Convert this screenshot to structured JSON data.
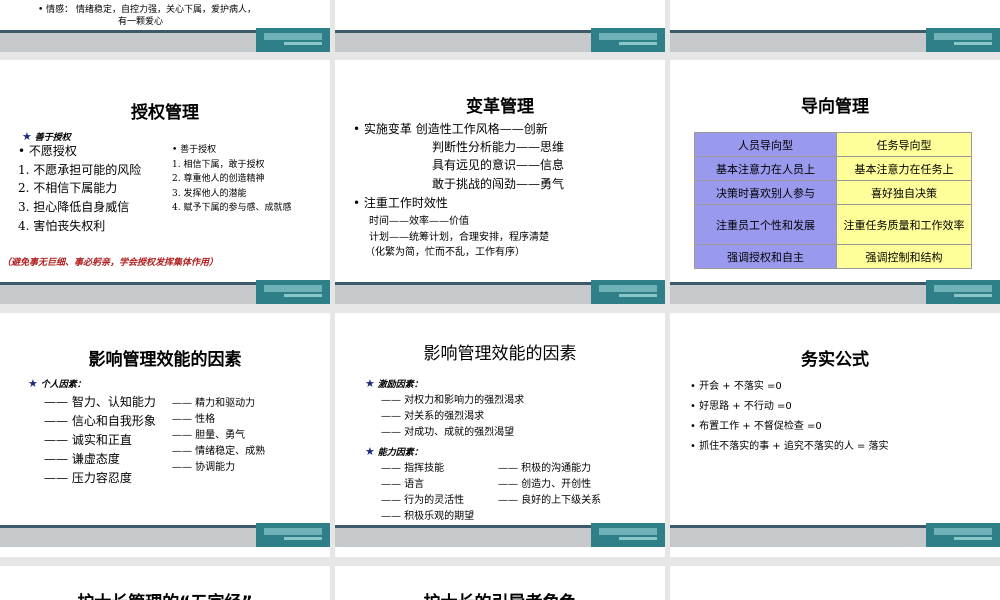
{
  "slides": {
    "top_left": {
      "line": "•  情感：  情绪稳定，自控力强，关心下属，爱护病人，",
      "line2": "有一颗爱心"
    },
    "empower": {
      "title": "授权管理",
      "left_header": "善于授权",
      "left_items": [
        "•   不愿授权",
        "1.  不愿承担可能的风险",
        "2.  不相信下属能力",
        "3.  担心降低自身威信",
        "4.  害怕丧失权利"
      ],
      "right_items": [
        "•      善于授权",
        "1.    相信下属，敢于授权",
        "2.    尊重他人的创造精神",
        "3.    发挥他人的潜能",
        "4.    赋予下属的参与感、成就感"
      ],
      "note": "（避免事无巨细、事必躬亲，学会授权发挥集体作用）"
    },
    "change": {
      "title": "变革管理",
      "lines": [
        "•  实施变革    创造性工作风格——创新",
        "判断性分析能力——思维",
        "具有远见的意识——信息",
        "敢于挑战的闯劲——勇气",
        "•  注重工作时效性",
        "时间——效率——价值",
        "计划——统筹计划，合理安排，程序清楚",
        "（化繁为简，忙而不乱，工作有序）"
      ]
    },
    "orient": {
      "title": "导向管理",
      "rows": [
        [
          "人员导向型",
          "任务导向型"
        ],
        [
          "基本注意力在人员上",
          "基本注意力在任务上"
        ],
        [
          "决策时喜欢别人参与",
          "喜好独自决策"
        ],
        [
          "注重员工个性和发展",
          "注重任务质量和工作效率"
        ],
        [
          "强调授权和自主",
          "强调控制和结构"
        ]
      ]
    },
    "factors1": {
      "title": "影响管理效能的因素",
      "header": "个人因素：",
      "left": [
        "—— 智力、认知能力",
        "—— 信心和自我形象",
        "—— 诚实和正直",
        "—— 谦虚态度",
        "—— 压力容忍度"
      ],
      "right": [
        "—— 精力和驱动力",
        "—— 性格",
        "—— 胆量、勇气",
        "—— 情绪稳定、成熟",
        "—— 协调能力"
      ]
    },
    "factors2": {
      "title": "影响管理效能的因素",
      "header1": "激励因素：",
      "motives": [
        "—— 对权力和影响力的强烈渴求",
        "—— 对关系的强烈渴求",
        "—— 对成功、成就的强烈渴望"
      ],
      "header2": "能力因素：",
      "abilities_left": [
        "—— 指挥技能",
        "—— 语言",
        "—— 行为的灵活性",
        "—— 积极乐观的期望"
      ],
      "abilities_right": [
        "—— 积极的沟通能力",
        "—— 创造力、开创性",
        "—— 良好的上下级关系"
      ]
    },
    "formula": {
      "title": "务实公式",
      "items": [
        "•  开会 + 不落实 =0",
        "•  好思路 + 不行动 =0",
        "•  布置工作 + 不督促检查 =0",
        "•  抓住不落实的事 + 追究不落实的人 = 落实"
      ]
    },
    "bottom_left": {
      "title": "护士长管理的“五字经”"
    },
    "bottom_mid": {
      "title": "护士长的引导者角色"
    }
  }
}
